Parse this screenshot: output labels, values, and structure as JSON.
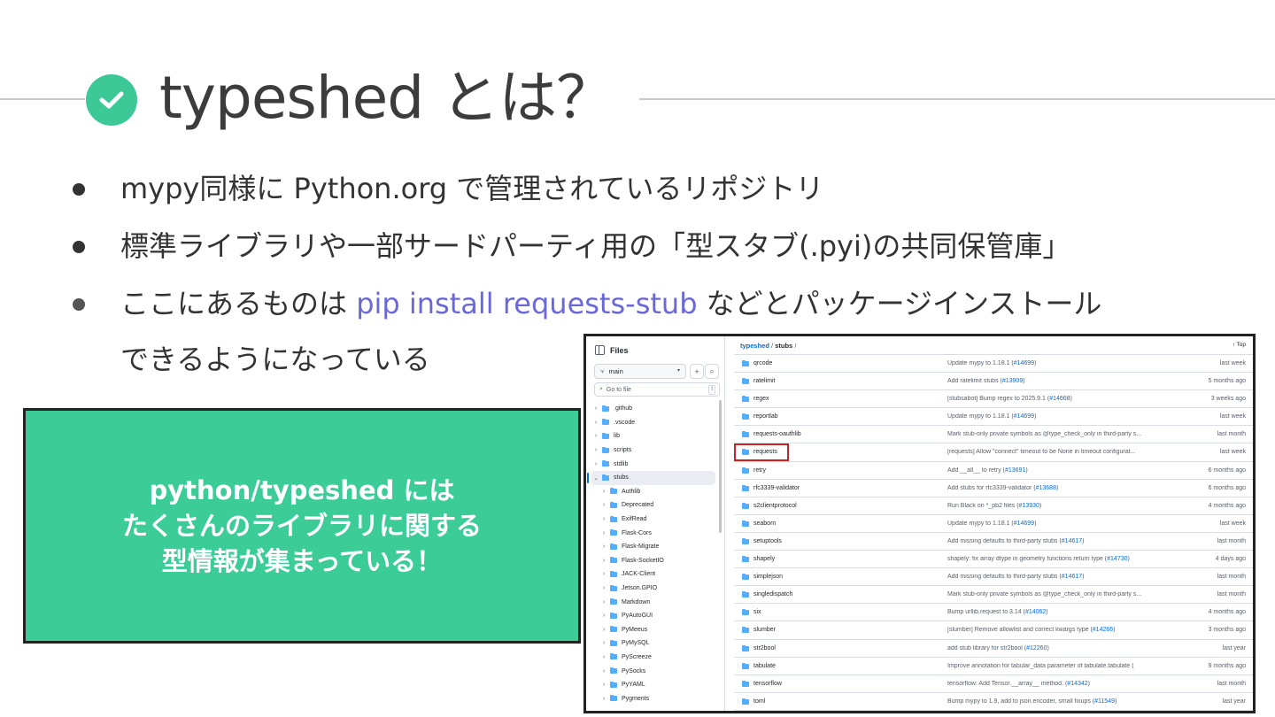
{
  "slide": {
    "title": "typeshed とは？",
    "bullets": [
      "mypy同様に Python.org で管理されているリポジトリ",
      "標準ライブラリや一部サードパーティ用の「型スタブ(.pyi)の共同保管庫」"
    ],
    "bullet3_prefix": "ここにあるものは ",
    "bullet3_code": "pip install requests-stub",
    "bullet3_suffix": " などとパッケージインストール",
    "bullet3_cont": "できるようになっている",
    "callout_lines": [
      "python/typeshed には",
      "たくさんのライブラリに関する",
      "型情報が集まっている！"
    ],
    "accent_color": "#3bcc98",
    "code_color": "#6a68d8"
  },
  "github": {
    "sidebar": {
      "header": "Files",
      "branch": "main",
      "goto_placeholder": "Go to file",
      "goto_kbd": "t",
      "tree": [
        {
          "label": ".github",
          "level": 0,
          "expanded": false
        },
        {
          "label": ".vscode",
          "level": 0,
          "expanded": false
        },
        {
          "label": "lib",
          "level": 0,
          "expanded": false
        },
        {
          "label": "scripts",
          "level": 0,
          "expanded": false
        },
        {
          "label": "stdlib",
          "level": 0,
          "expanded": false
        },
        {
          "label": "stubs",
          "level": 0,
          "expanded": true,
          "selected": true
        },
        {
          "label": "Authlib",
          "level": 1
        },
        {
          "label": "Deprecated",
          "level": 1
        },
        {
          "label": "ExifRead",
          "level": 1
        },
        {
          "label": "Flask-Cors",
          "level": 1
        },
        {
          "label": "Flask-Migrate",
          "level": 1
        },
        {
          "label": "Flask-SocketIO",
          "level": 1
        },
        {
          "label": "JACK-Client",
          "level": 1
        },
        {
          "label": "Jetson.GPIO",
          "level": 1
        },
        {
          "label": "Markdown",
          "level": 1
        },
        {
          "label": "PyAutoGUI",
          "level": 1
        },
        {
          "label": "PyMeeus",
          "level": 1
        },
        {
          "label": "PyMySQL",
          "level": 1
        },
        {
          "label": "PyScreeze",
          "level": 1
        },
        {
          "label": "PySocks",
          "level": 1
        },
        {
          "label": "PyYAML",
          "level": 1
        },
        {
          "label": "Pygments",
          "level": 1
        }
      ]
    },
    "breadcrumb": {
      "repo": "typeshed",
      "sep": "/",
      "dir": "stubs",
      "tail": "/"
    },
    "top_link": "↑ Top",
    "rows": [
      {
        "name": "qrcode",
        "msg": "Update mypy to 1.18.1 (",
        "pr": "#14699",
        "tail": ")",
        "date": "last week"
      },
      {
        "name": "ratelimit",
        "msg": "Add ratelimit stubs (",
        "pr": "#13909",
        "tail": ")",
        "date": "5 months ago"
      },
      {
        "name": "regex",
        "msg": "[stubsabot] Bump regex to 2025.9.1 (",
        "pr": "#14668",
        "tail": ")",
        "date": "3 weeks ago"
      },
      {
        "name": "reportlab",
        "msg": "Update mypy to 1.18.1 (",
        "pr": "#14699",
        "tail": ")",
        "date": "last week"
      },
      {
        "name": "requests-oauthlib",
        "msg": "Mark stub-only private symbols as @type_check_only in third-party s...",
        "pr": "",
        "tail": "",
        "date": "last month"
      },
      {
        "name": "requests",
        "msg": "[requests] Allow \"connect\" timeout to be None in timeout configurat...",
        "pr": "",
        "tail": "",
        "date": "last week",
        "highlight": true
      },
      {
        "name": "retry",
        "msg": "Add __all__ to retry (",
        "pr": "#13691",
        "tail": ")",
        "date": "6 months ago"
      },
      {
        "name": "rfc3339-validator",
        "msg": "Add stubs for rfc3339-validator (",
        "pr": "#13688",
        "tail": ")",
        "date": "6 months ago"
      },
      {
        "name": "s2clientprotocol",
        "msg": "Run Black on *_pb2 files (",
        "pr": "#13930",
        "tail": ")",
        "date": "4 months ago"
      },
      {
        "name": "seaborn",
        "msg": "Update mypy to 1.18.1 (",
        "pr": "#14699",
        "tail": ")",
        "date": "last week"
      },
      {
        "name": "setuptools",
        "msg": "Add missing defaults to third-party stubs (",
        "pr": "#14617",
        "tail": ")",
        "date": "last month"
      },
      {
        "name": "shapely",
        "msg": "shapely: fix array dtype in geometry functions return type (",
        "pr": "#14730",
        "tail": ")",
        "date": "4 days ago"
      },
      {
        "name": "simplejson",
        "msg": "Add missing defaults to third-party stubs (",
        "pr": "#14617",
        "tail": ")",
        "date": "last month"
      },
      {
        "name": "singledispatch",
        "msg": "Mark stub-only private symbols as @type_check_only in third-party s...",
        "pr": "",
        "tail": "",
        "date": "last month"
      },
      {
        "name": "six",
        "msg": "Bump urllib.request to 3.14 (",
        "pr": "#14062",
        "tail": ")",
        "date": "4 months ago"
      },
      {
        "name": "slumber",
        "msg": "[slumber] Remove allowlist and correct kwargs type (",
        "pr": "#14266",
        "tail": ")",
        "date": "3 months ago"
      },
      {
        "name": "str2bool",
        "msg": "add stub library for str2bool (",
        "pr": "#12260",
        "tail": ")",
        "date": "last year"
      },
      {
        "name": "tabulate",
        "msg": "Improve annotation for tabular_data parameter of tabulate.tabulate (",
        "pr": "",
        "tail": "",
        "date": "9 months ago"
      },
      {
        "name": "tensorflow",
        "msg": "tensorflow: Add Tensor.__array__ method. (",
        "pr": "#14342",
        "tail": ")",
        "date": "last month"
      },
      {
        "name": "toml",
        "msg": "Bump mypy to 1.9, add to json.encoder, small fixups (",
        "pr": "#11549",
        "tail": ")",
        "date": "last year"
      }
    ]
  }
}
